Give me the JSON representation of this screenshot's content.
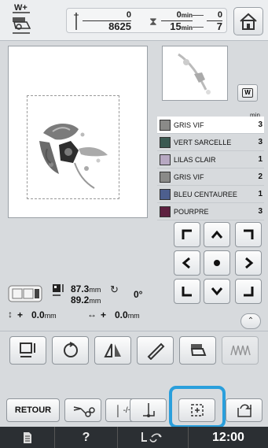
{
  "header": {
    "wt_label": "W+",
    "stitch_count": {
      "current": "0",
      "total": "8625"
    },
    "time": {
      "current": "0",
      "total": "15",
      "unit": "min"
    },
    "color_count": {
      "current": "0",
      "total": "7"
    }
  },
  "side_panel": {
    "min_label": "min"
  },
  "thread_colors": [
    {
      "name": "GRIS VIF",
      "minutes": "3",
      "color": "#8a8a88"
    },
    {
      "name": "VERT SARCELLE",
      "minutes": "3",
      "color": "#3b5a52"
    },
    {
      "name": "LILAS CLAIR",
      "minutes": "1",
      "color": "#b7a8c2"
    },
    {
      "name": "GRIS VIF",
      "minutes": "2",
      "color": "#8a8a88"
    },
    {
      "name": "BLEU CENTAUREE",
      "minutes": "1",
      "color": "#4d5f8e"
    },
    {
      "name": "POURPRE",
      "minutes": "3",
      "color": "#5e2140"
    }
  ],
  "position_info": {
    "width": "87.3",
    "height": "89.2",
    "unit": "mm",
    "rotation": "0°",
    "offset_y_sign": "+",
    "offset_y": "0.0",
    "offset_x_sign": "+",
    "offset_x": "0.0"
  },
  "bottom_bar": {
    "retour_label": "RETOUR",
    "needle_plus_minus": "-/+",
    "clock": "12:00"
  },
  "icons": {
    "home": "home-icon",
    "help": "help-icon",
    "document": "document-icon"
  }
}
